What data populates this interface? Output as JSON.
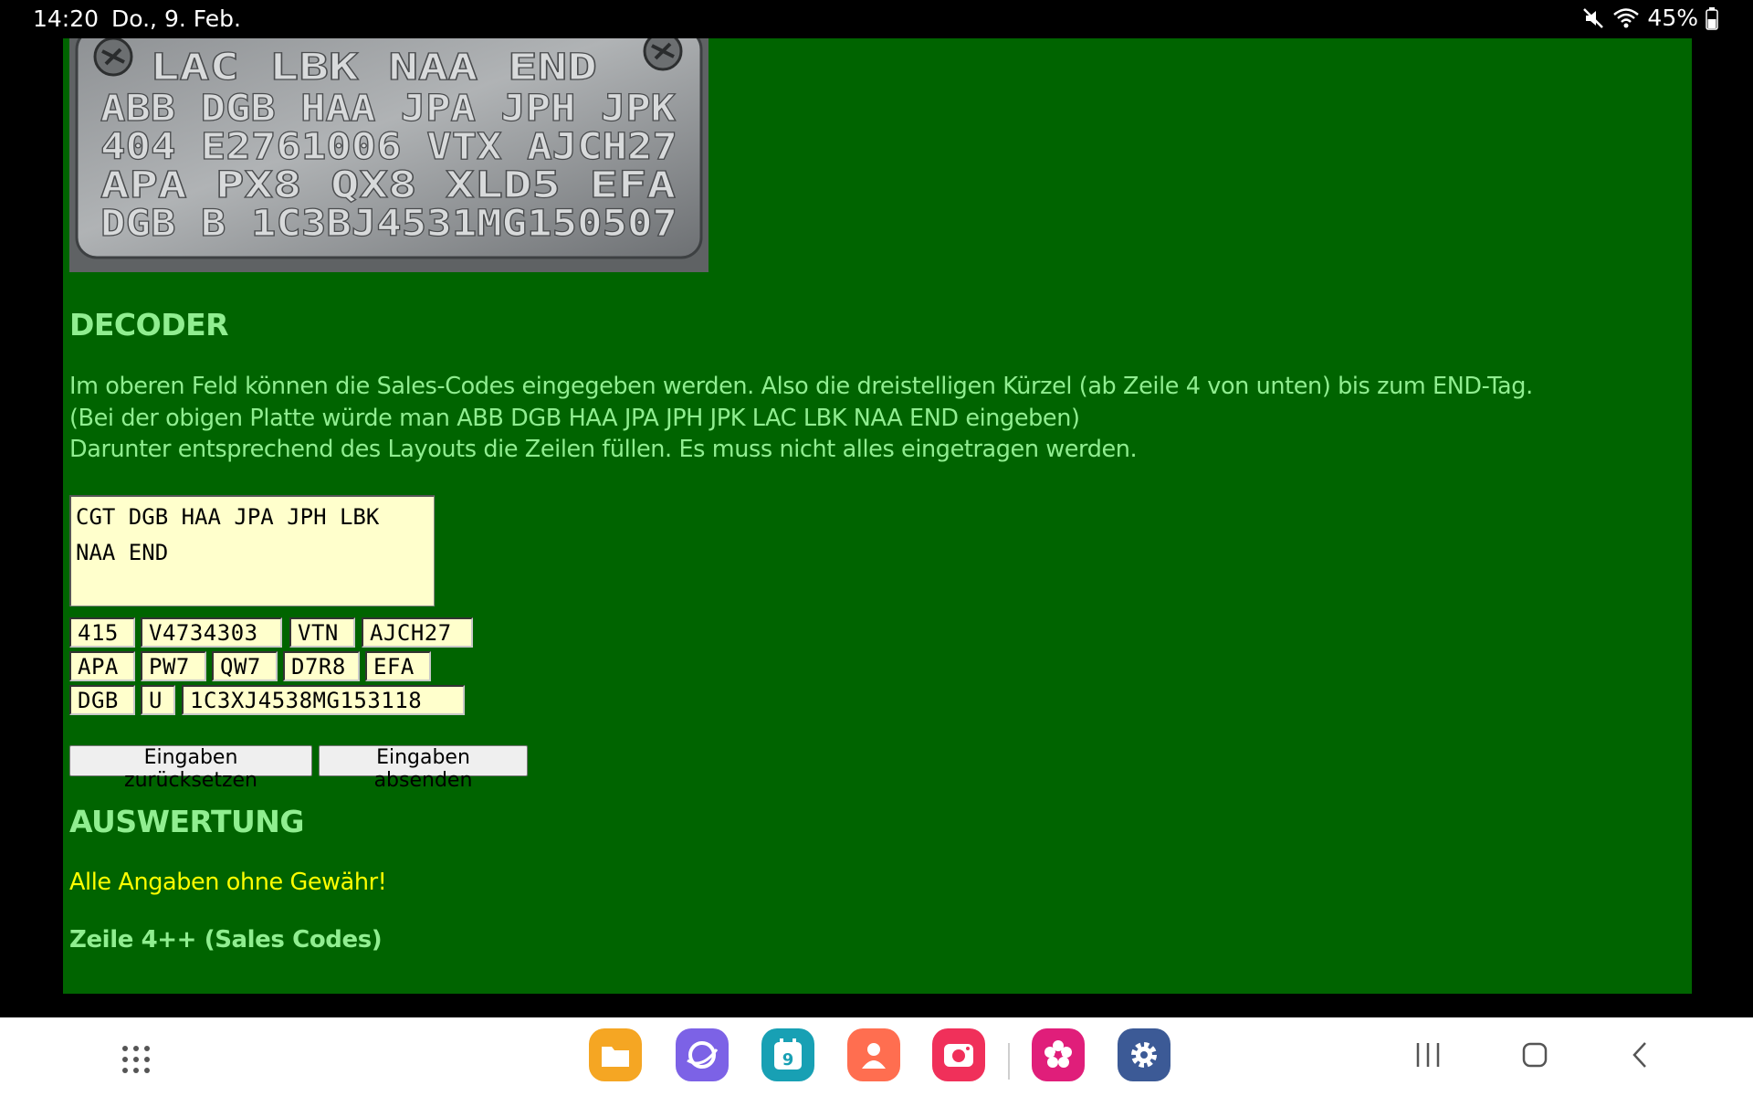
{
  "status_bar": {
    "time": "14:20",
    "date": "Do., 9. Feb.",
    "battery": "45%",
    "icons": [
      "mute-icon",
      "wifi-icon",
      "battery-icon"
    ]
  },
  "plate_image": {
    "alt": "Fender tag",
    "lines": [
      "LAC LBK NAA END",
      "ABB DGB HAA JPA JPH JPK",
      "404 E2761006 VTX AJCH27",
      "APA PX8  QX8  XLD5 EFA",
      "DGB B 1C3BJ4531MG150507"
    ]
  },
  "decoder": {
    "title": "DECODER",
    "intro_lines": [
      "Im oberen Feld können die Sales-Codes eingegeben werden. Also die dreistelligen Kürzel (ab Zeile 4 von unten) bis zum END-Tag.",
      "(Bei der obigen Platte würde man ABB DGB HAA JPA JPH JPK LAC LBK NAA END eingeben)",
      "Darunter entsprechend des Layouts die Zeilen füllen. Es muss nicht alles eingetragen werden."
    ],
    "sales_codes_value": "CGT DGB HAA JPA JPH LBK\nNAA END",
    "row1": [
      "415",
      "V4734303",
      "VTN",
      "AJCH27"
    ],
    "row2": [
      "APA",
      "PW7",
      "QW7",
      "D7R8",
      "EFA"
    ],
    "row3": [
      "DGB",
      "U",
      "1C3XJ4538MG153118"
    ],
    "reset_label": "Eingaben zurücksetzen",
    "submit_label": "Eingaben absenden"
  },
  "result": {
    "title": "AUSWERTUNG",
    "warning": "Alle Angaben ohne Gewähr!",
    "subheading": "Zeile 4++ (Sales Codes)"
  },
  "taskbar": {
    "calendar_day": "9",
    "apps": [
      "apps-grid-icon",
      "my-files-icon",
      "samsung-internet-icon",
      "calendar-icon",
      "contacts-icon",
      "camera-icon",
      "gallery-icon",
      "settings-icon"
    ],
    "nav": [
      "recent-apps-icon",
      "home-icon",
      "back-icon"
    ],
    "colors": {
      "page_bg": "#006400",
      "heading": "#90ee90",
      "warning": "#ffff00",
      "field_bg": "#ffffcc"
    }
  }
}
